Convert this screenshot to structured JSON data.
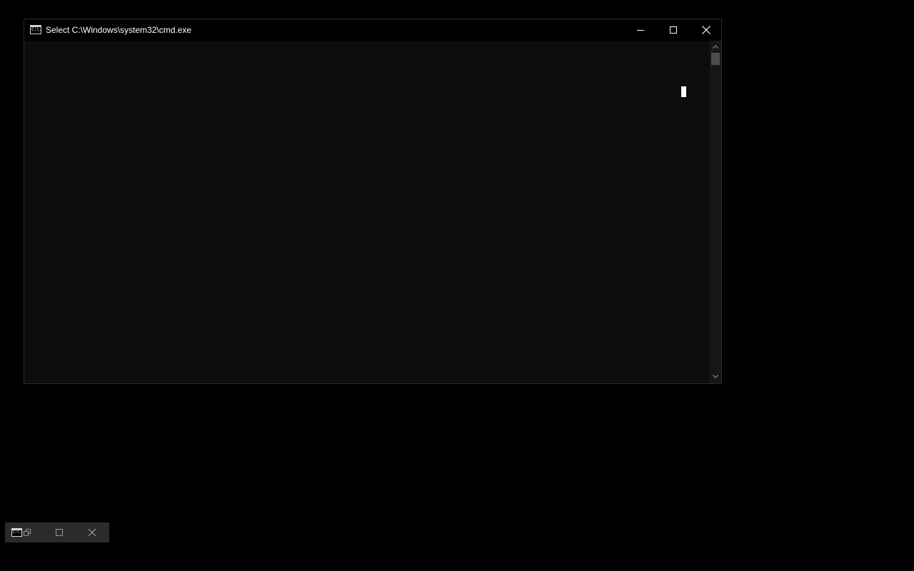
{
  "window": {
    "title": "Select C:\\Windows\\system32\\cmd.exe",
    "app_icon_text": "C:\\.",
    "icon": "console-icon",
    "buttons": {
      "minimize": "minimize-icon",
      "maximize": "maximize-icon",
      "close": "close-icon"
    },
    "console_bg": "#0c0c0c",
    "titlebar_bg": "#000000",
    "text_color": "#ffffff"
  },
  "scrollbar": {
    "up": "chevron-up-icon",
    "down": "chevron-down-icon",
    "position": 0
  },
  "minimized_bar": {
    "app_icon_text": "C:\\.",
    "icons": [
      "console-icon",
      "restore-icon",
      "maximize-icon",
      "close-icon"
    ],
    "bg": "#2b2b2b"
  }
}
